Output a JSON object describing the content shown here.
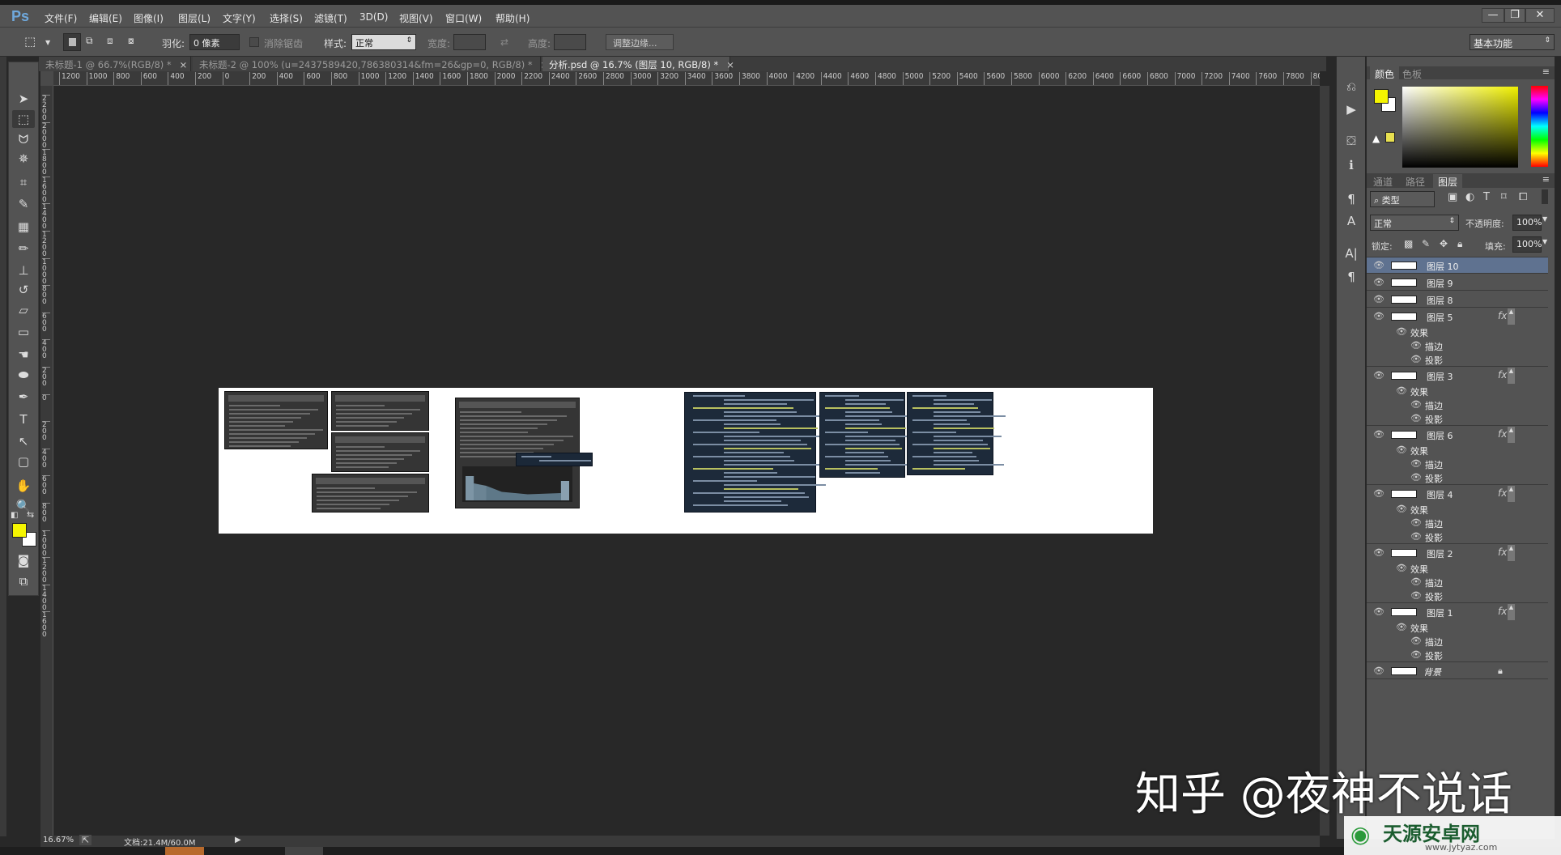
{
  "app": {
    "logo": "Ps"
  },
  "menu": [
    "文件(F)",
    "编辑(E)",
    "图像(I)",
    "图层(L)",
    "文字(Y)",
    "选择(S)",
    "滤镜(T)",
    "3D(D)",
    "视图(V)",
    "窗口(W)",
    "帮助(H)"
  ],
  "window_buttons": {
    "minimize": "—",
    "restore": "❐",
    "close": "✕"
  },
  "options": {
    "feather_label": "羽化:",
    "feather_value": "0 像素",
    "antialias_label": "消除锯齿",
    "style_label": "样式:",
    "style_value": "正常",
    "width_label": "宽度:",
    "height_label": "高度:",
    "refine_edge": "调整边缘...",
    "workspace": "基本功能"
  },
  "tabs": [
    {
      "label": "未标题-1 @ 66.7%(RGB/8) *",
      "active": false
    },
    {
      "label": "未标题-2 @ 100% (u=2437589420,786380314&fm=26&gp=0, RGB/8) *",
      "active": false
    },
    {
      "label": "分析.psd @ 16.7% (图层 10, RGB/8) *",
      "active": true
    }
  ],
  "close_glyph": "×",
  "hruler": [
    "1200",
    "1000",
    "800",
    "600",
    "400",
    "200",
    "0",
    "200",
    "400",
    "600",
    "800",
    "1000",
    "1200",
    "1400",
    "1600",
    "1800",
    "2000",
    "2200",
    "2400",
    "2600",
    "2800",
    "3000",
    "3200",
    "3400",
    "3600",
    "3800",
    "4000",
    "4200",
    "4400",
    "4600",
    "4800",
    "5000",
    "5200",
    "5400",
    "5600",
    "5800",
    "6000",
    "6200",
    "6400",
    "6600",
    "6800",
    "7000",
    "7200",
    "7400",
    "7600",
    "7800",
    "8000"
  ],
  "vruler": [
    "2200",
    "2000",
    "1800",
    "1600",
    "1400",
    "1200",
    "1000",
    "800",
    "600",
    "400",
    "200",
    "0",
    "200",
    "400",
    "600",
    "800",
    "1000",
    "1200",
    "1400",
    "1600"
  ],
  "tools": [
    {
      "icon": "move-icon",
      "glyph": "➤"
    },
    {
      "icon": "rect-marquee-icon",
      "glyph": "⬚",
      "active": true
    },
    {
      "icon": "lasso-icon",
      "glyph": "ᗢ"
    },
    {
      "icon": "magic-wand-icon",
      "glyph": "✵"
    },
    {
      "icon": "crop-icon",
      "glyph": "⌗"
    },
    {
      "icon": "eyedropper-icon",
      "glyph": "✎"
    },
    {
      "icon": "healing-brush-icon",
      "glyph": "▦"
    },
    {
      "icon": "brush-icon",
      "glyph": "✏"
    },
    {
      "icon": "clone-stamp-icon",
      "glyph": "⊥"
    },
    {
      "icon": "history-brush-icon",
      "glyph": "↺"
    },
    {
      "icon": "eraser-icon",
      "glyph": "▱"
    },
    {
      "icon": "gradient-icon",
      "glyph": "▭"
    },
    {
      "icon": "blur-icon",
      "glyph": "☚"
    },
    {
      "icon": "dodge-icon",
      "glyph": "⬬"
    },
    {
      "icon": "pen-icon",
      "glyph": "✒"
    },
    {
      "icon": "type-icon",
      "glyph": "T"
    },
    {
      "icon": "path-select-icon",
      "glyph": "↖"
    },
    {
      "icon": "shape-icon",
      "glyph": "▢"
    },
    {
      "icon": "hand-icon",
      "glyph": "✋"
    },
    {
      "icon": "zoom-icon",
      "glyph": "🔍"
    }
  ],
  "colors": {
    "foreground": "#f5f500",
    "background": "#ffffff",
    "gamut_swatch": "#e8e050",
    "selected_layer": "#5f7290"
  },
  "panel_strip": [
    {
      "icon": "history-icon",
      "glyph": "⎌"
    },
    {
      "icon": "actions-play-icon",
      "glyph": "▶"
    },
    {
      "icon": "3d-icon",
      "glyph": "⛋"
    },
    {
      "icon": "info-icon",
      "glyph": "ℹ"
    },
    {
      "icon": "paragraph-style-icon",
      "glyph": "¶"
    },
    {
      "icon": "character-style-icon",
      "glyph": "A"
    },
    {
      "icon": "character-icon",
      "glyph": "A|"
    },
    {
      "icon": "paragraph-icon",
      "glyph": "¶"
    }
  ],
  "color_panel": {
    "tabs": [
      "颜色",
      "色板"
    ],
    "warning": "▲"
  },
  "layers_panel": {
    "tabs": [
      "通道",
      "路径",
      "图层"
    ],
    "filter": "类型",
    "blend_mode": "正常",
    "opacity_label": "不透明度:",
    "opacity": "100%",
    "lock_label": "锁定:",
    "fill_label": "填充:",
    "fill": "100%",
    "fx": "fx",
    "layers": [
      {
        "name": "图层 10",
        "selected": true,
        "fx": false
      },
      {
        "name": "图层 9",
        "fx": false
      },
      {
        "name": "图层 8",
        "fx": false
      },
      {
        "name": "图层 5",
        "fx": true,
        "effects": [
          "效果",
          "描边",
          "投影"
        ]
      },
      {
        "name": "图层 3",
        "fx": true,
        "effects": [
          "效果",
          "描边",
          "投影"
        ]
      },
      {
        "name": "图层 6",
        "fx": true,
        "effects": [
          "效果",
          "描边",
          "投影"
        ]
      },
      {
        "name": "图层 4",
        "fx": true,
        "effects": [
          "效果",
          "描边",
          "投影"
        ]
      },
      {
        "name": "图层 2",
        "fx": true,
        "effects": [
          "效果",
          "描边",
          "投影"
        ]
      },
      {
        "name": "图层 1",
        "fx": true,
        "effects": [
          "效果",
          "描边",
          "投影"
        ]
      },
      {
        "name": "背景",
        "fx": false,
        "locked": true
      }
    ]
  },
  "status": {
    "zoom": "16.67%",
    "doc": "文档:21.4M/60.0M"
  },
  "watermark": "知乎 @夜神不说话",
  "site": {
    "name": "天源安卓网",
    "url": "www.jytyaz.com"
  }
}
